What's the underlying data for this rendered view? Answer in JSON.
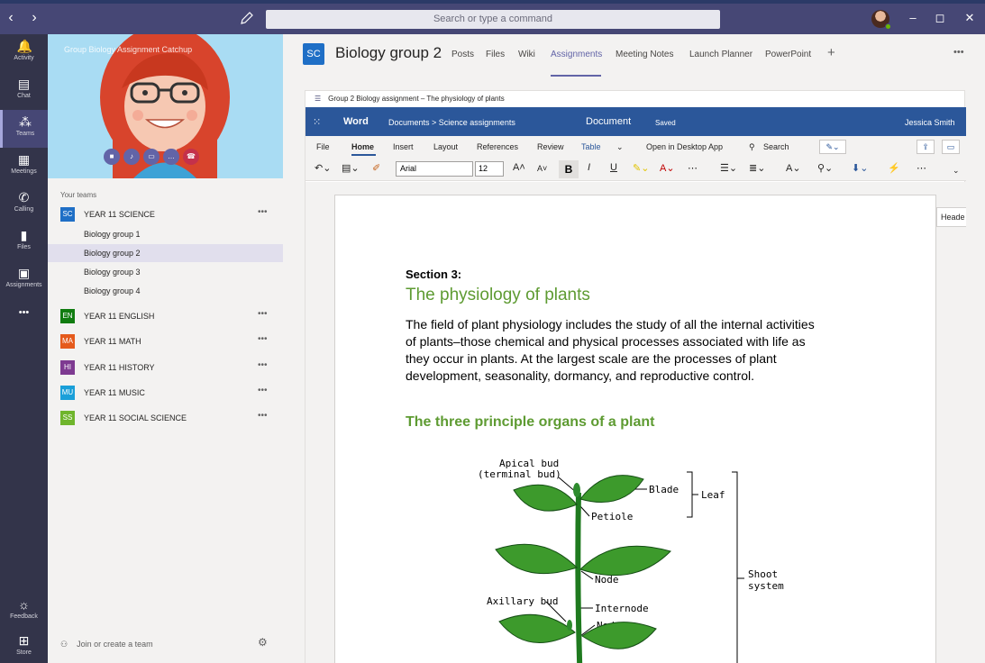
{
  "titlebar": {
    "search_placeholder": "Search or type a command",
    "back": "‹",
    "forward": "›",
    "minimize": "–",
    "maximize": "◻",
    "close": "✕"
  },
  "rail": {
    "items": [
      {
        "label": "Activity",
        "icon": "bell-icon",
        "glyph": "🔔"
      },
      {
        "label": "Chat",
        "icon": "chat-icon",
        "glyph": "▤"
      },
      {
        "label": "Teams",
        "icon": "teams-icon",
        "glyph": "⁂"
      },
      {
        "label": "Meetings",
        "icon": "calendar-icon",
        "glyph": "▦"
      },
      {
        "label": "Calling",
        "icon": "phone-icon",
        "glyph": "✆"
      },
      {
        "label": "Files",
        "icon": "file-icon",
        "glyph": "▮"
      },
      {
        "label": "Assignments",
        "icon": "backpack-icon",
        "glyph": "▣"
      },
      {
        "label": "",
        "icon": "more-icon",
        "glyph": "•••"
      }
    ],
    "bottom": [
      {
        "label": "Feedback",
        "icon": "feedback-icon",
        "glyph": "☼"
      },
      {
        "label": "Store",
        "icon": "store-icon",
        "glyph": "⊞"
      }
    ]
  },
  "panel": {
    "hero_title": "Group Biology Assignment Catchup",
    "your_teams": "Your teams",
    "teams": [
      {
        "abbr": "SC",
        "name": "YEAR 11 SCIENCE",
        "color": "#1f6fc6"
      },
      {
        "abbr": "EN",
        "name": "YEAR 11 ENGLISH",
        "color": "#107c10"
      },
      {
        "abbr": "MA",
        "name": "YEAR 11 MATH",
        "color": "#e55a1c"
      },
      {
        "abbr": "HI",
        "name": "YEAR 11 HISTORY",
        "color": "#7e3a91"
      },
      {
        "abbr": "MU",
        "name": "YEAR 11 MUSIC",
        "color": "#1a9fd9"
      },
      {
        "abbr": "SS",
        "name": "YEAR 11 SOCIAL SCIENCE",
        "color": "#6fb52c"
      }
    ],
    "channels": [
      "Biology group 1",
      "Biology group 2",
      "Biology group 3",
      "Biology group 4"
    ],
    "more": "•••",
    "join": "Join or create a team"
  },
  "main": {
    "avatar": "SC",
    "title": "Biology group 2",
    "tabs": [
      "Posts",
      "Files",
      "Wiki",
      "Assignments",
      "Meeting Notes",
      "Launch Planner",
      "PowerPoint"
    ],
    "add": "+",
    "more": "•••"
  },
  "doc": {
    "breadcrumb": "Group 2 Biology assignment – The physiology of plants",
    "word": "Word",
    "path": "Documents  >  Science assignments",
    "doc_name": "Document",
    "saved": "Saved",
    "user": "Jessica Smith",
    "ribbon_tabs": [
      "File",
      "Home",
      "Insert",
      "Layout",
      "References",
      "Review",
      "Table",
      "Open in Desktop App",
      "Search"
    ],
    "font": "Arial",
    "size": "12",
    "header_tab": "Heade",
    "section_label": "Section 3:",
    "section_title": "The physiology of plants",
    "body_lines": [
      "The field of plant physiology includes the study of all the internal activities",
      "of plants–those chemical and physical processes associated with life as",
      "they occur in plants. At the largest scale are the processes of plant",
      "development, seasonality, dormancy, and reproductive control."
    ],
    "organs_title": "The three principle organs of a plant",
    "diagram_labels": {
      "apical": "Apical bud",
      "terminal": "(terminal bud)",
      "blade": "Blade",
      "leaf": "Leaf",
      "petiole": "Petiole",
      "node1": "Node",
      "axillary": "Axillary bud",
      "internode": "Internode",
      "node2": "Node",
      "shoot1": "Shoot",
      "shoot2": "system"
    }
  },
  "colors": {
    "titlebar": "#464775",
    "rail": "#33344a",
    "accent": "#6264a7",
    "word_blue": "#2b579a",
    "heading_green": "#5e9b32"
  }
}
